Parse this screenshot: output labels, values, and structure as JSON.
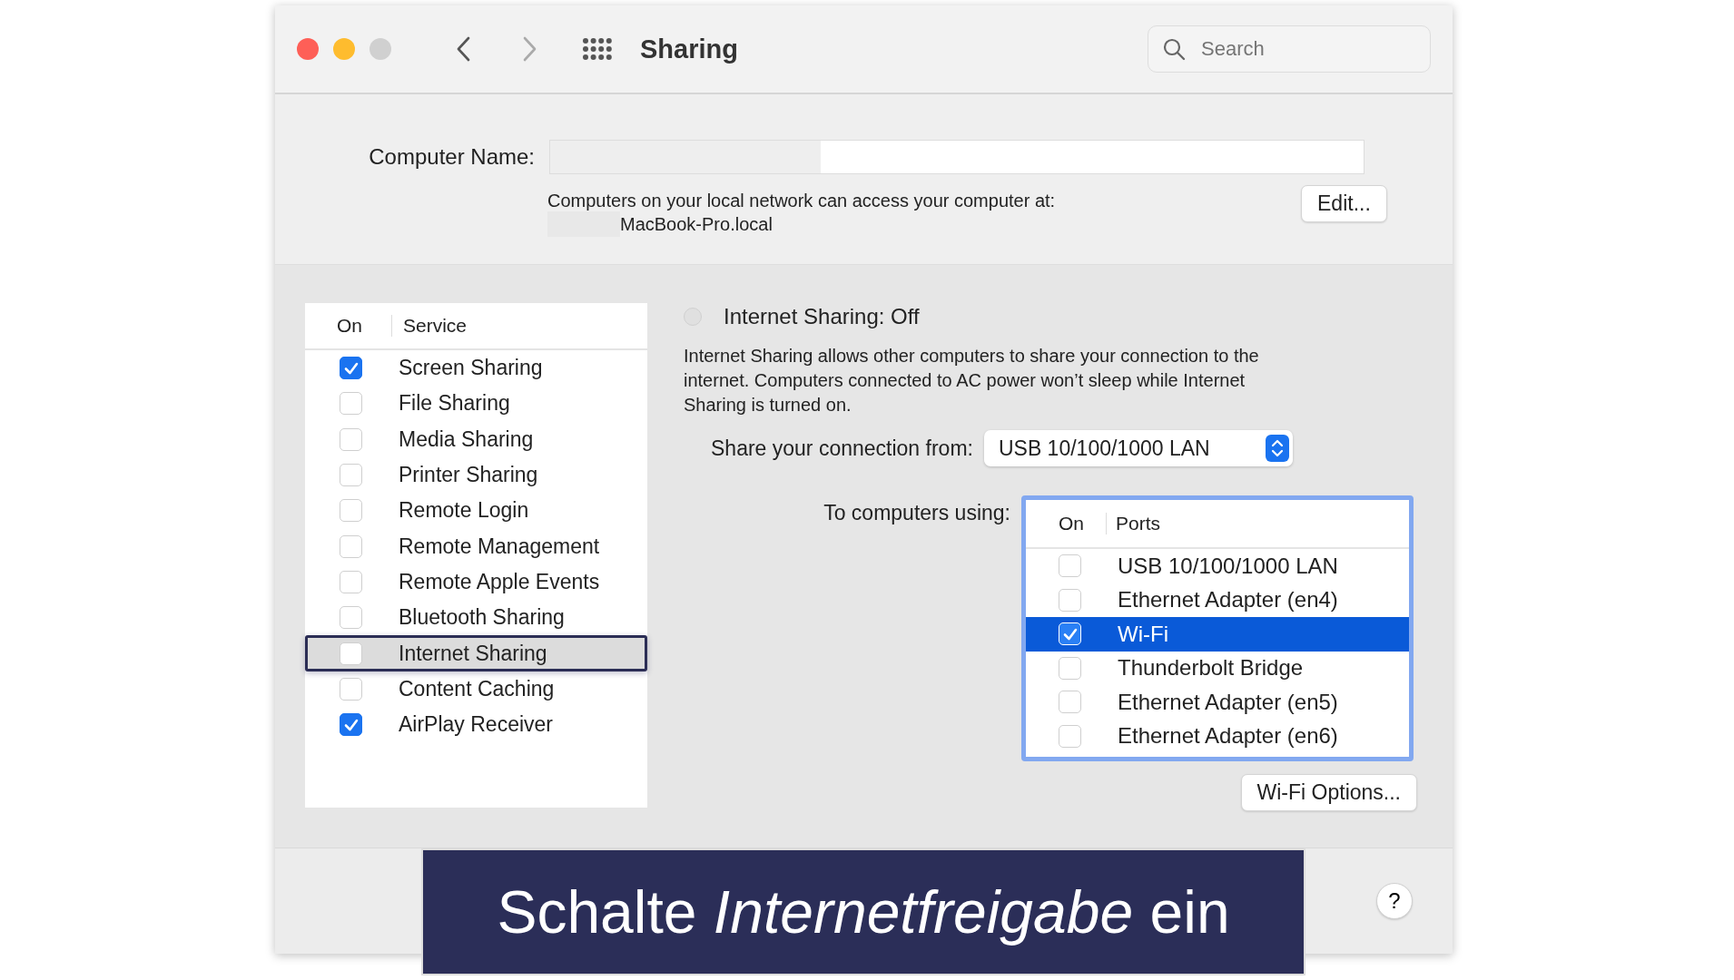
{
  "window": {
    "title": "Sharing",
    "search": {
      "placeholder": "Search"
    }
  },
  "computer_name": {
    "label": "Computer Name:",
    "note": "Computers on your local network can access your computer at:",
    "address": "MacBook-Pro.local",
    "edit_button": "Edit..."
  },
  "services": {
    "columns": [
      "On",
      "Service"
    ],
    "items": [
      {
        "name": "Screen Sharing",
        "checked": true,
        "selected": false
      },
      {
        "name": "File Sharing",
        "checked": false,
        "selected": false
      },
      {
        "name": "Media Sharing",
        "checked": false,
        "selected": false
      },
      {
        "name": "Printer Sharing",
        "checked": false,
        "selected": false
      },
      {
        "name": "Remote Login",
        "checked": false,
        "selected": false
      },
      {
        "name": "Remote Management",
        "checked": false,
        "selected": false
      },
      {
        "name": "Remote Apple Events",
        "checked": false,
        "selected": false
      },
      {
        "name": "Bluetooth Sharing",
        "checked": false,
        "selected": false
      },
      {
        "name": "Internet Sharing",
        "checked": false,
        "selected": true
      },
      {
        "name": "Content Caching",
        "checked": false,
        "selected": false
      },
      {
        "name": "AirPlay Receiver",
        "checked": true,
        "selected": false
      }
    ]
  },
  "detail": {
    "status": {
      "label": "Internet Sharing: Off",
      "on": false
    },
    "description": "Internet Sharing allows other computers to share your connection to the internet. Computers connected to AC power won’t sleep while Internet Sharing is turned on.",
    "share_from": {
      "label": "Share your connection from:",
      "value": "USB 10/100/1000 LAN"
    },
    "to_computers_label": "To computers using:",
    "ports": {
      "columns": [
        "On",
        "Ports"
      ],
      "items": [
        {
          "name": "USB 10/100/1000 LAN",
          "checked": false,
          "selected": false
        },
        {
          "name": "Ethernet Adapter (en4)",
          "checked": false,
          "selected": false
        },
        {
          "name": "Wi-Fi",
          "checked": true,
          "selected": true
        },
        {
          "name": "Thunderbolt Bridge",
          "checked": false,
          "selected": false
        },
        {
          "name": "Ethernet Adapter (en5)",
          "checked": false,
          "selected": false
        },
        {
          "name": "Ethernet Adapter (en6)",
          "checked": false,
          "selected": false
        }
      ]
    },
    "wifi_options_button": "Wi-Fi Options..."
  },
  "help_button": "?",
  "caption": "Schalte *Internetfreigabe* ein"
}
